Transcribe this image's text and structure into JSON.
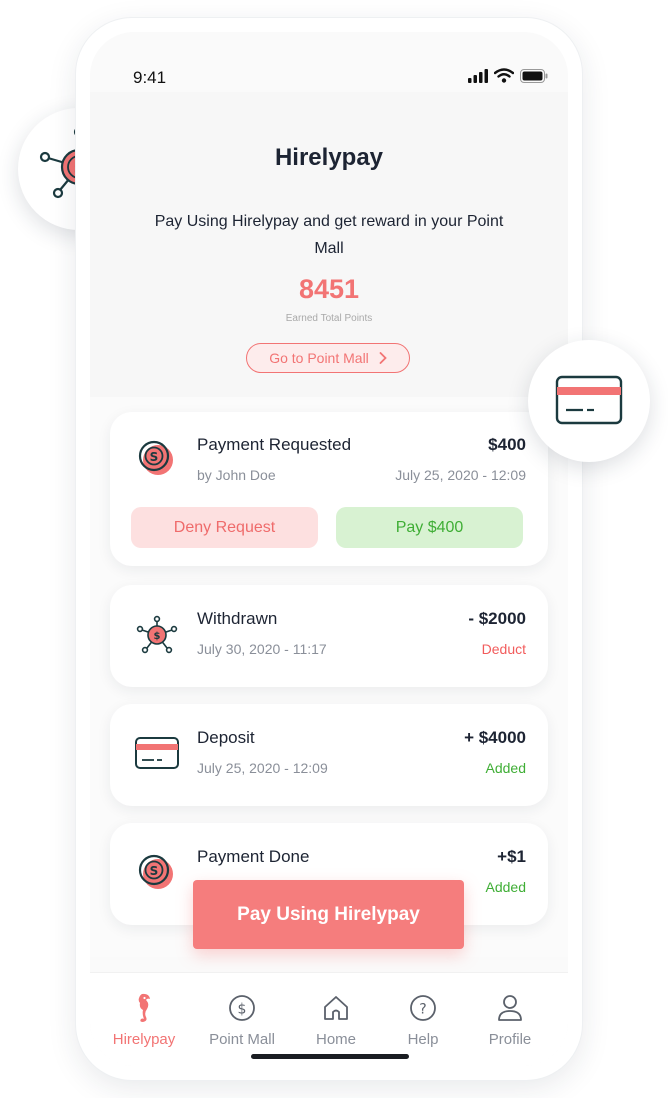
{
  "status_bar": {
    "time": "9:41"
  },
  "header": {
    "title": "Hirelypay",
    "subtitle": "Pay Using Hirelypay and get reward in your Point Mall",
    "points": "8451",
    "points_label": "Earned Total Points",
    "mall_button": "Go to Point Mall"
  },
  "transactions": [
    {
      "title": "Payment Requested",
      "subtitle": "by John Doe",
      "amount": "$400",
      "meta": "July 25, 2020 - 12:09",
      "icon": "coin-cycle-icon",
      "actions": {
        "deny": "Deny Request",
        "pay": "Pay $400"
      }
    },
    {
      "title": "Withdrawn",
      "subtitle": "July 30, 2020 - 11:17",
      "amount": "- $2000",
      "meta": "Deduct",
      "meta_color": "#f25c5c",
      "icon": "network-dollar-icon"
    },
    {
      "title": "Deposit",
      "subtitle": "July 25, 2020 - 12:09",
      "amount": "+ $4000",
      "meta": "Added",
      "meta_color": "#3fae35",
      "icon": "credit-card-icon"
    },
    {
      "title": "Payment Done",
      "amount": "+$1",
      "meta": "Added",
      "meta_color": "#3fae35",
      "icon": "coin-cycle-icon"
    }
  ],
  "cta": {
    "label": "Pay Using Hirelypay"
  },
  "tabbar": {
    "items": [
      {
        "label": "Hirelypay",
        "icon": "seahorse-icon",
        "active": true
      },
      {
        "label": "Point Mall",
        "icon": "dollar-circle-icon"
      },
      {
        "label": "Home",
        "icon": "home-icon"
      },
      {
        "label": "Help",
        "icon": "question-icon"
      },
      {
        "label": "Profile",
        "icon": "user-icon"
      }
    ]
  },
  "colors": {
    "accent": "#f27474",
    "green": "#3fae35",
    "dark": "#1d2433"
  }
}
